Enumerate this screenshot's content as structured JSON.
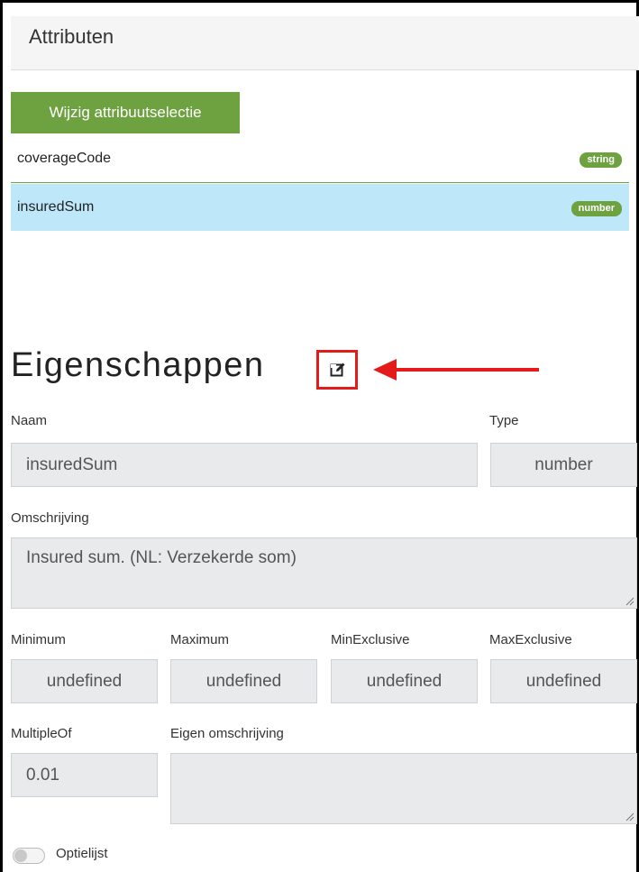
{
  "header": {
    "title": "Attributen"
  },
  "attributes": {
    "change_button_label": "Wijzig attribuutselectie",
    "items": [
      {
        "name": "coverageCode",
        "type": "string",
        "selected": false
      },
      {
        "name": "insuredSum",
        "type": "number",
        "selected": true
      }
    ]
  },
  "properties": {
    "title": "Eigenschappen",
    "naam_label": "Naam",
    "naam_value": "insuredSum",
    "type_label": "Type",
    "type_value": "number",
    "omschrijving_label": "Omschrijving",
    "omschrijving_value": "Insured sum. (NL: Verzekerde som)",
    "minimum_label": "Minimum",
    "minimum_value": "undefined",
    "maximum_label": "Maximum",
    "maximum_value": "undefined",
    "minexclusive_label": "MinExclusive",
    "minexclusive_value": "undefined",
    "maxexclusive_label": "MaxExclusive",
    "maxexclusive_value": "undefined",
    "multipleof_label": "MultipleOf",
    "multipleof_value": "0.01",
    "eigen_omschrijving_label": "Eigen omschrijving",
    "eigen_omschrijving_value": "",
    "optielijst_label": "Optielijst",
    "optielijst_enabled": false
  },
  "icons": {
    "edit": "edit-icon",
    "toggle": "toggle-switch"
  },
  "colors": {
    "accent_green": "#6ea13f",
    "selected_row": "#bfe7fa",
    "highlight_red": "#e31b1b"
  }
}
